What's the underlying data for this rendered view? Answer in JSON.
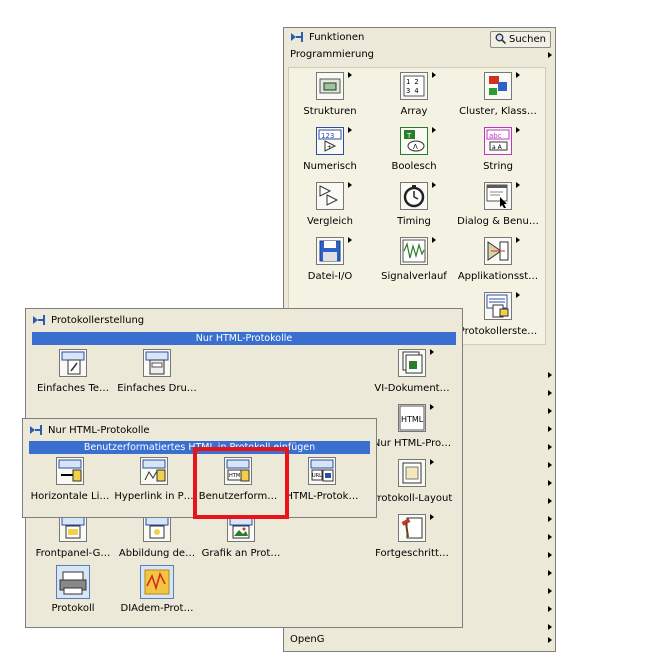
{
  "colors": {
    "highlight": "#e8141a",
    "header_bar": "#3a6fd0",
    "palette_bg": "#ece9d8"
  },
  "funktionen": {
    "title": "Funktionen",
    "search_label": "Suchen",
    "category": "Programmierung",
    "items": [
      {
        "label": "Strukturen",
        "icon": "structures-icon"
      },
      {
        "label": "Array",
        "icon": "array-icon"
      },
      {
        "label": "Cluster, Klass…",
        "icon": "cluster-icon"
      },
      {
        "label": "Numerisch",
        "icon": "numeric-icon"
      },
      {
        "label": "Boolesch",
        "icon": "boolean-icon"
      },
      {
        "label": "String",
        "icon": "string-icon"
      },
      {
        "label": "Vergleich",
        "icon": "comparison-icon"
      },
      {
        "label": "Timing",
        "icon": "timing-icon"
      },
      {
        "label": "Dialog & Benu…",
        "icon": "dialog-icon"
      },
      {
        "label": "Datei-I/O",
        "icon": "file-io-icon"
      },
      {
        "label": "Signalverlauf",
        "icon": "waveform-icon"
      },
      {
        "label": "Applikationsst…",
        "icon": "application-control-icon"
      },
      {
        "label": "Protokollerste…",
        "icon": "report-generation-icon"
      }
    ],
    "bottom_category": "OpenG"
  },
  "protokoll": {
    "title": "Protokollerstellung",
    "header": "Nur HTML-Protokolle",
    "items": [
      {
        "label": "Einfaches Te…"
      },
      {
        "label": "Einfaches Dru…"
      },
      {
        "label": "VI-Dokument…"
      },
      {
        "label": "Nur HTML-Pro…"
      },
      {
        "label": "Protokoll-Layout"
      },
      {
        "label": "Frontpanel-G…"
      },
      {
        "label": "Abbildung de…"
      },
      {
        "label": "Grafik an Prot…"
      },
      {
        "label": "Fortgeschritt…"
      },
      {
        "label": "Protokoll"
      },
      {
        "label": "DIAdem-Prot…"
      }
    ],
    "html_icon_text": "HTML"
  },
  "nur_html": {
    "title": "Nur HTML-Protokolle",
    "header": "Benutzerformatiertes HTML in Protokoll einfügen",
    "items": [
      {
        "label": "Horizontale Li…"
      },
      {
        "label": "Hyperlink in P…"
      },
      {
        "label": "Benutzerform…"
      },
      {
        "label": "HTML-Protok…"
      }
    ]
  }
}
